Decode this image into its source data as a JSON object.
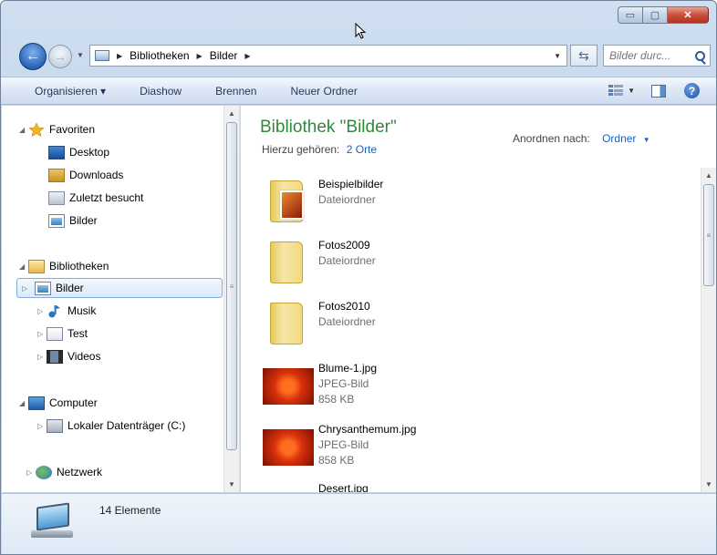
{
  "window": {
    "controls": {
      "minimize": "▭",
      "maximize": "▢",
      "close": "✕"
    }
  },
  "address": {
    "crumbs": [
      "Bibliotheken",
      "Bilder"
    ],
    "search_placeholder": "Bilder durc...",
    "refresh_glyph": "⇆"
  },
  "toolbar": {
    "organize": "Organisieren ▾",
    "slideshow": "Diashow",
    "burn": "Brennen",
    "new_folder": "Neuer Ordner",
    "help": "?"
  },
  "nav": {
    "favorites": "Favoriten",
    "fav_items": [
      "Desktop",
      "Downloads",
      "Zuletzt besucht",
      "Bilder"
    ],
    "libraries": "Bibliotheken",
    "lib_items": [
      "Bilder",
      "Musik",
      "Test",
      "Videos"
    ],
    "computer": "Computer",
    "comp_items": [
      "Lokaler Datenträger (C:)"
    ],
    "network": "Netzwerk"
  },
  "library": {
    "title": "Bibliothek \"Bilder\"",
    "includes_label": "Hierzu gehören:",
    "includes_link": "2 Orte",
    "arrange_label": "Anordnen nach:",
    "arrange_value": "Ordner"
  },
  "files": [
    {
      "name": "Beispielbilder",
      "type": "Dateiordner",
      "size": ""
    },
    {
      "name": "Fotos2009",
      "type": "Dateiordner",
      "size": ""
    },
    {
      "name": "Fotos2010",
      "type": "Dateiordner",
      "size": ""
    },
    {
      "name": "Blume-1.jpg",
      "type": "JPEG-Bild",
      "size": "858 KB"
    },
    {
      "name": "Chrysanthemum.jpg",
      "type": "JPEG-Bild",
      "size": "858 KB"
    },
    {
      "name": "Desert.jpg",
      "type": "",
      "size": ""
    }
  ],
  "status": {
    "count": "14 Elemente"
  },
  "colors": {
    "title_green": "#2e8a3a",
    "link_blue": "#1a62c4",
    "accent": "#2a62b8"
  }
}
